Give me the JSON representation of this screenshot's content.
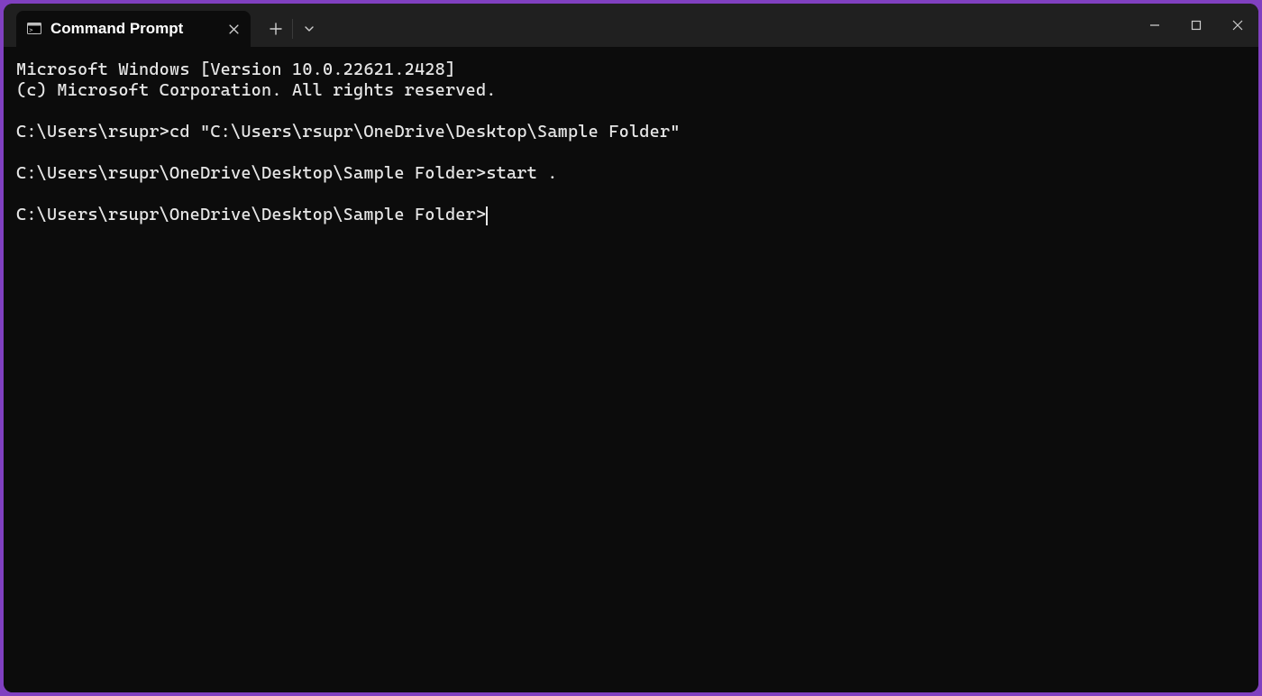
{
  "tab": {
    "title": "Command Prompt"
  },
  "terminal": {
    "line1": "Microsoft Windows [Version 10.0.22621.2428]",
    "line2": "(c) Microsoft Corporation. All rights reserved.",
    "blank1": "",
    "prompt1": "C:\\Users\\rsupr>",
    "cmd1": "cd \"C:\\Users\\rsupr\\OneDrive\\Desktop\\Sample Folder\"",
    "blank2": "",
    "prompt2": "C:\\Users\\rsupr\\OneDrive\\Desktop\\Sample Folder>",
    "cmd2": "start .",
    "blank3": "",
    "prompt3": "C:\\Users\\rsupr\\OneDrive\\Desktop\\Sample Folder>"
  }
}
